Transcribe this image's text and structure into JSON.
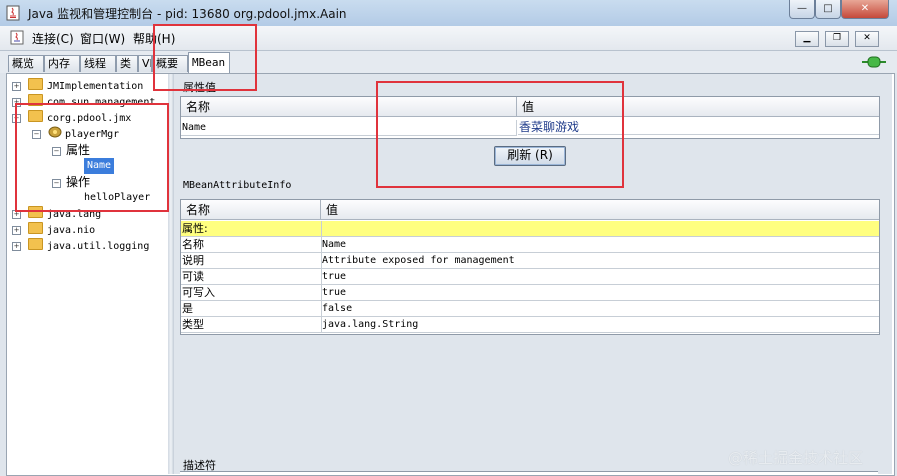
{
  "window": {
    "title": "Java 监视和管理控制台 - pid: 13680 org.pdool.jmx.Aain"
  },
  "menu": {
    "connect": "连接(C)",
    "window": "窗口(W)",
    "help": "帮助(H)"
  },
  "tabs": [
    "概览",
    "内存",
    "线程",
    "类",
    "VM",
    "概要",
    "MBean"
  ],
  "tree": {
    "nodes": [
      "JMImplementation",
      "com.sun.management",
      "corg.pdool.jmx",
      "playerMgr",
      "属性",
      "Name",
      "操作",
      "helloPlayer",
      "java.lang",
      "java.nio",
      "java.util.logging"
    ]
  },
  "attribute_values": {
    "title": "属性值",
    "headers": [
      "名称",
      "值"
    ],
    "row": {
      "name": "Name",
      "value": "香菜聊游戏"
    },
    "refresh_label": "刷新 (R)"
  },
  "attribute_info": {
    "title": "MBeanAttributeInfo",
    "headers": [
      "名称",
      "值"
    ],
    "section_label": "属性:",
    "rows": [
      {
        "name": "名称",
        "value": "Name"
      },
      {
        "name": "说明",
        "value": "Attribute exposed for management"
      },
      {
        "name": "可读",
        "value": "true"
      },
      {
        "name": "可写入",
        "value": "true"
      },
      {
        "name": "是",
        "value": "false"
      },
      {
        "name": "类型",
        "value": "java.lang.String"
      }
    ]
  },
  "descriptor": {
    "title": "描述符"
  },
  "watermark": "@稀土掘金技术社区",
  "colors": {
    "highlight_row": "#ffff80",
    "selection": "#3b7ddc",
    "annotation_red": "#e0333c",
    "value_link": "#1f3b8a"
  },
  "icons": {
    "app": "java-cup-icon",
    "connection": "green-plug-icon"
  }
}
